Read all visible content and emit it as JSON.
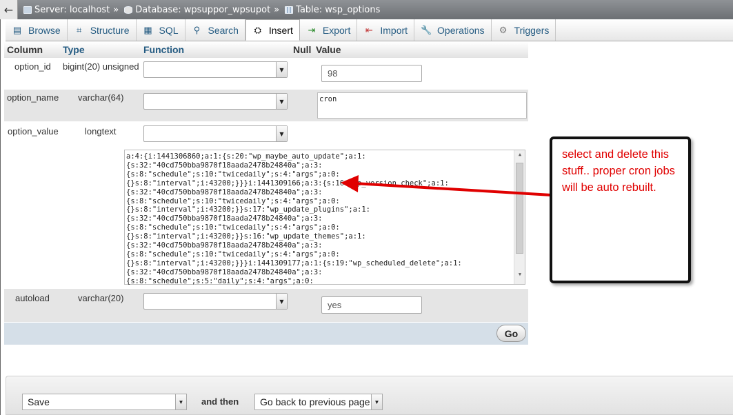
{
  "breadcrumb": {
    "server": "Server: localhost",
    "database": "Database: wpsuppor_wpsupot",
    "table": "Table: wsp_options",
    "separator": "»"
  },
  "tabs": [
    {
      "label": "Browse",
      "icon": "browse-icon"
    },
    {
      "label": "Structure",
      "icon": "structure-icon"
    },
    {
      "label": "SQL",
      "icon": "sql-icon"
    },
    {
      "label": "Search",
      "icon": "search-icon"
    },
    {
      "label": "Insert",
      "icon": "insert-icon",
      "active": true
    },
    {
      "label": "Export",
      "icon": "export-icon"
    },
    {
      "label": "Import",
      "icon": "import-icon"
    },
    {
      "label": "Operations",
      "icon": "wrench-icon"
    },
    {
      "label": "Triggers",
      "icon": "triggers-icon"
    }
  ],
  "headers": {
    "column": "Column",
    "type": "Type",
    "function": "Function",
    "null": "Null",
    "value": "Value"
  },
  "rows": {
    "option_id": {
      "column": "option_id",
      "type": "bigint(20) unsigned",
      "value": "98"
    },
    "option_name": {
      "column": "option_name",
      "type": "varchar(64)",
      "value": "cron"
    },
    "option_value": {
      "column": "option_value",
      "type": "longtext",
      "lines": [
        "a:4:{i:1441306860;a:1:{s:20:\"wp_maybe_auto_update\";a:1:",
        "{s:32:\"40cd750bba9870f18aada2478b24840a\";a:3:",
        "{s:8:\"schedule\";s:10:\"twicedaily\";s:4:\"args\";a:0:",
        "{}s:8:\"interval\";i:43200;}}}i:1441309166;a:3:{s:16:\"wp_version_check\";a:1:",
        "{s:32:\"40cd750bba9870f18aada2478b24840a\";a:3:",
        "{s:8:\"schedule\";s:10:\"twicedaily\";s:4:\"args\";a:0:",
        "{}s:8:\"interval\";i:43200;}}s:17:\"wp_update_plugins\";a:1:",
        "{s:32:\"40cd750bba9870f18aada2478b24840a\";a:3:",
        "{s:8:\"schedule\";s:10:\"twicedaily\";s:4:\"args\";a:0:",
        "{}s:8:\"interval\";i:43200;}}s:16:\"wp_update_themes\";a:1:",
        "{s:32:\"40cd750bba9870f18aada2478b24840a\";a:3:",
        "{s:8:\"schedule\";s:10:\"twicedaily\";s:4:\"args\";a:0:",
        "{}s:8:\"interval\";i:43200;}}}i:1441309177;a:1:{s:19:\"wp_scheduled_delete\";a:1:",
        "{s:32:\"40cd750bba9870f18aada2478b24840a\";a:3:",
        "{s:8:\"schedule\";s:5:\"daily\";s:4:\"args\";a:0:"
      ]
    },
    "autoload": {
      "column": "autoload",
      "type": "varchar(20)",
      "value": "yes"
    }
  },
  "go_label": "Go",
  "bottom": {
    "action": "Save",
    "and_then": "and then",
    "after": "Go back to previous page"
  },
  "annotation": {
    "text": "select and delete this stuff.. proper cron jobs will be auto rebuilt.",
    "color": "#e00000"
  },
  "colors": {
    "accent": "#235a81",
    "arrow": "#e00000"
  }
}
